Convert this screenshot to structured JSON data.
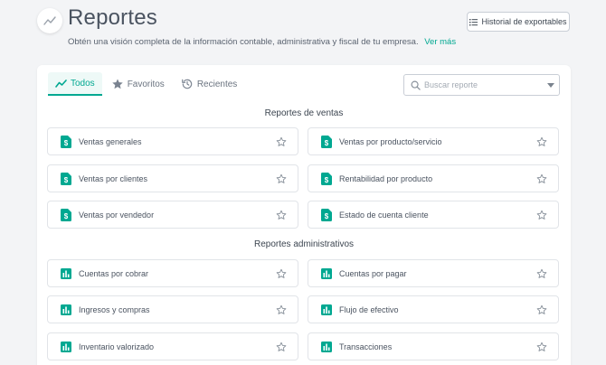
{
  "header": {
    "title": "Reportes",
    "subtitle": "Obtén una visión completa de la información contable, administrativa y fiscal de tu empresa.",
    "more_link": "Ver más",
    "export_button": "Historial de exportables"
  },
  "tabs": [
    {
      "label": "Todos",
      "icon": "trend-line-icon",
      "active": true
    },
    {
      "label": "Favoritos",
      "icon": "star-icon",
      "active": false
    },
    {
      "label": "Recientes",
      "icon": "history-icon",
      "active": false
    }
  ],
  "search": {
    "placeholder": "Buscar reporte",
    "value": ""
  },
  "sections": [
    {
      "title": "Reportes de ventas",
      "icon": "dollar-document-icon",
      "items": [
        "Ventas generales",
        "Ventas por producto/servicio",
        "Ventas por clientes",
        "Rentabilidad por producto",
        "Ventas por vendedor",
        "Estado de cuenta cliente"
      ]
    },
    {
      "title": "Reportes administrativos",
      "icon": "bar-chart-icon",
      "items": [
        "Cuentas por cobrar",
        "Cuentas por pagar",
        "Ingresos y compras",
        "Flujo de efectivo",
        "Inventario valorizado",
        "Transacciones"
      ]
    }
  ],
  "colors": {
    "accent": "#00a891",
    "text": "#4a5360",
    "border": "#e1e4e8",
    "background": "#f3f4f6"
  }
}
